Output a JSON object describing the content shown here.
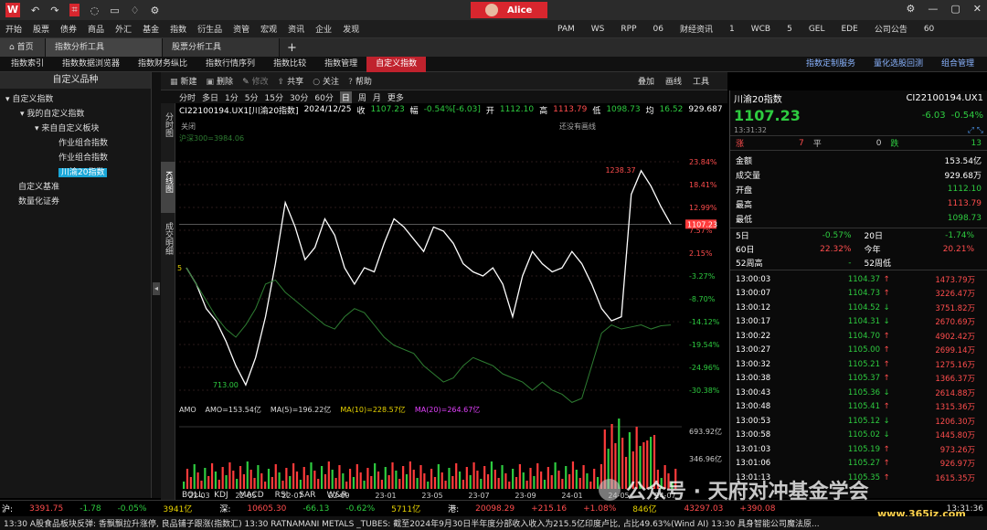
{
  "titlebar": {
    "user": "Alice",
    "left_icons": [
      "undo-icon",
      "redo-icon",
      "crop-icon",
      "chat-icon",
      "monitor-icon",
      "bell-icon",
      "settings-icon"
    ]
  },
  "menubar": {
    "left": [
      "开始",
      "股票",
      "债券",
      "商品",
      "外汇",
      "基金",
      "指数",
      "衍生品",
      "资管",
      "宏观",
      "资讯",
      "企业",
      "发现"
    ],
    "right": [
      "PAM",
      "WS",
      "RPP",
      "06",
      "财经资讯",
      "1",
      "WCB",
      "5",
      "GEL",
      "EDE",
      "公司公告",
      "60"
    ]
  },
  "tabs": [
    "首页",
    "指数分析工具",
    "股票分析工具"
  ],
  "subtabs": [
    "指数索引",
    "指数数据浏览器",
    "指数财务纵比",
    "指数行情序列",
    "指数比较",
    "指数管理",
    "自定义指数"
  ],
  "subtabs_right": [
    "指数定制服务",
    "量化选股回测",
    "组合管理"
  ],
  "left": {
    "title": "自定义品种",
    "tree": [
      {
        "label": "▾ 自定义指数",
        "indent": 6
      },
      {
        "label": "▾ 我的自定义指数",
        "indent": 22
      },
      {
        "label": "▾ 来自自定义板块",
        "indent": 38
      },
      {
        "label": "作业组合指数",
        "indent": 64
      },
      {
        "label": "作业组合指数",
        "indent": 64
      },
      {
        "label": "川渝20指数",
        "indent": 64,
        "selected": true
      },
      {
        "label": "自定义基准",
        "indent": 20
      },
      {
        "label": "数量化证券",
        "indent": 20
      }
    ]
  },
  "chart_toolbar": {
    "items": [
      "新建",
      "删除",
      "修改",
      "共享",
      "关注",
      "帮助"
    ],
    "right": [
      "叠加",
      "画线",
      "工具"
    ]
  },
  "periods": [
    "分时",
    "多日",
    "1分",
    "5分",
    "15分",
    "30分",
    "60分",
    "日",
    "周",
    "月",
    "更多"
  ],
  "vtabs": [
    "分时图",
    "K线图",
    "成交明细"
  ],
  "chart_header": {
    "code": "CI22100194.UX1[川渝20指数]",
    "date": "2024/12/25",
    "close_label": "收",
    "close": "1107.23",
    "chg_label": "幅",
    "chg": "-0.54%[-6.03]",
    "open_label": "开",
    "open": "1112.10",
    "high_label": "高",
    "high": "1113.79",
    "low_label": "低",
    "low": "1098.73",
    "avg_label": "均",
    "avg": "16.52",
    "amt": "929.687",
    "close_btn": "关闭",
    "no_lines": "还没有画线",
    "bench": "沪深300=3984.06"
  },
  "chart_labels": {
    "max": "1238.37",
    "min": "713.00",
    "current": "1107.23",
    "start": "5"
  },
  "chart_data": {
    "type": "line",
    "x_ticks": [
      "22-03",
      "22-05",
      "22-07",
      "22-09",
      "23-01",
      "23-05",
      "23-07",
      "23-09",
      "24-01",
      "24-05",
      "24-07"
    ],
    "y_right_pct": [
      "23.84%",
      "18.41%",
      "12.99%",
      "7.57%",
      "2.15%",
      "-3.27%",
      "-8.70%",
      "-14.12%",
      "-19.54%",
      "-24.96%",
      "-30.38%"
    ],
    "series": [
      {
        "name": "川渝20指数",
        "color": "#ffffff",
        "values": [
          1000,
          960,
          900,
          870,
          820,
          760,
          713,
          780,
          880,
          1010,
          1160,
          1100,
          1020,
          1050,
          1120,
          1080,
          1000,
          960,
          1000,
          990,
          1060,
          1120,
          1100,
          1070,
          1040,
          1100,
          1090,
          1060,
          1010,
          990,
          980,
          1000,
          960,
          880,
          980,
          1040,
          1010,
          990,
          1000,
          1040,
          1010,
          960,
          900,
          870,
          880,
          1180,
          1238,
          1200,
          1150,
          1107
        ]
      },
      {
        "name": "沪深300",
        "color": "#2e7d32",
        "values": [
          1000,
          960,
          920,
          880,
          850,
          830,
          860,
          900,
          960,
          970,
          940,
          920,
          900,
          880,
          860,
          850,
          880,
          900,
          890,
          860,
          830,
          810,
          800,
          790,
          760,
          740,
          720,
          730,
          760,
          780,
          770,
          760,
          740,
          730,
          720,
          700,
          720,
          700,
          690,
          670,
          680,
          760,
          840,
          860,
          850,
          855,
          860,
          850,
          858,
          860
        ]
      }
    ]
  },
  "volume": {
    "label": "AMO",
    "amo": "AMO=153.54亿",
    "ma5": "MA(5)=196.22亿",
    "ma10": "MA(10)=228.57亿",
    "ma20": "MA(20)=264.67亿",
    "ticks": [
      "693.92亿",
      "346.96亿"
    ]
  },
  "indicators": [
    "BOLL",
    "KDJ",
    "MACD",
    "RSI",
    "SAR",
    "W&R"
  ],
  "quote": {
    "name": "川渝20指数",
    "code": "CI22100194.UX1",
    "price": "1107.23",
    "chg": "-6.03",
    "pct": "-0.54%",
    "time": "13:31:32",
    "rise_label": "涨",
    "rise": "7",
    "flat_label": "平",
    "flat": "0",
    "fall_label": "跌",
    "fall": "13",
    "fields": [
      [
        "金额",
        "153.54亿"
      ],
      [
        "成交量",
        "929.68万"
      ],
      [
        "开盘",
        "1112.10"
      ],
      [
        "最高",
        "1113.79"
      ],
      [
        "最低",
        "1098.73"
      ]
    ],
    "periods": [
      [
        "5日",
        "-0.57%",
        "20日",
        "-1.74%"
      ],
      [
        "60日",
        "22.32%",
        "今年",
        "20.21%"
      ],
      [
        "52周高",
        "-",
        "52周低",
        ""
      ]
    ],
    "ticks": [
      [
        "13:00:03",
        "1104.37",
        "up",
        "1473.79万"
      ],
      [
        "13:00:07",
        "1104.73",
        "up",
        "3226.47万"
      ],
      [
        "13:00:12",
        "1104.52",
        "down",
        "3751.82万"
      ],
      [
        "13:00:17",
        "1104.31",
        "down",
        "2670.69万"
      ],
      [
        "13:00:22",
        "1104.70",
        "up",
        "4902.42万"
      ],
      [
        "13:00:27",
        "1105.00",
        "up",
        "2699.14万"
      ],
      [
        "13:00:32",
        "1105.21",
        "up",
        "1275.16万"
      ],
      [
        "13:00:38",
        "1105.37",
        "up",
        "1366.37万"
      ],
      [
        "13:00:43",
        "1105.36",
        "down",
        "2614.88万"
      ],
      [
        "13:00:48",
        "1105.41",
        "up",
        "1315.36万"
      ],
      [
        "13:00:53",
        "1105.12",
        "down",
        "1206.30万"
      ],
      [
        "13:00:58",
        "1105.02",
        "down",
        "1445.80万"
      ],
      [
        "13:01:03",
        "1105.19",
        "up",
        "973.26万"
      ],
      [
        "13:01:06",
        "1105.27",
        "up",
        "926.97万"
      ],
      [
        "13:01:13",
        "1105.35",
        "up",
        "1615.35万"
      ]
    ]
  },
  "statusbar": [
    [
      "沪:",
      "3391.75",
      "-1.78",
      "-0.05%",
      "3941亿"
    ],
    [
      "深:",
      "10605.30",
      "-66.13",
      "-0.62%",
      "5711亿"
    ],
    [
      "港:",
      "20098.29",
      "+215.16",
      "+1.08%",
      "846亿"
    ],
    [
      "",
      "43297.03",
      "+390.08",
      "",
      ""
    ]
  ],
  "statusbar_time": "13:31:36",
  "watermark": "公众号 · 天府对冲基金学会",
  "watermark2": "www.365jz.com",
  "news": "13:30  A股食品板块反弹: 香飘飘拉升涨停, 良品铺子跟涨(指数汇)     13:30  RATNAMANI METALS _TUBES: 截至2024年9月30日半年度分部收入收入为215.5亿印度卢比, 占比49.63%(Wind AI)     13:30  具身智能公司魔法原..."
}
